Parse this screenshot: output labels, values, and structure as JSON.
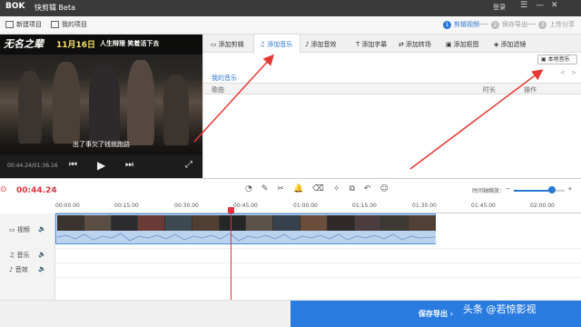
{
  "app": {
    "logo": "ΒOK",
    "title": "快剪辑 Beta",
    "login": "登录"
  },
  "window_controls": {
    "menu": "☰",
    "minimize": "—",
    "close": "✕"
  },
  "toolbar": {
    "new_project": "新建项目",
    "my_projects": "我的项目"
  },
  "steps": [
    {
      "num": "1",
      "label": "剪辑视频",
      "active": true
    },
    {
      "num": "2",
      "label": "保存导出",
      "active": false
    },
    {
      "num": "3",
      "label": "上传分享",
      "active": false
    }
  ],
  "video": {
    "banner_logo": "无名之辈",
    "banner_date": "11月16日",
    "banner_tag": "人生辩理 笑着活下去",
    "subtitle": "出了事欠了钱就跑路",
    "time_readout": "00:44.24/01:36.16"
  },
  "tabs": [
    {
      "label": "添加剪辑",
      "icon": "▭",
      "active": false
    },
    {
      "label": "添加音乐",
      "icon": "♫",
      "active": true
    },
    {
      "label": "添加音效",
      "icon": "♪",
      "active": false
    },
    {
      "label": "添加字幕",
      "icon": "T",
      "active": false
    },
    {
      "label": "添加转场",
      "icon": "⇄",
      "active": false
    },
    {
      "label": "添加抠图",
      "icon": "▣",
      "active": false
    },
    {
      "label": "添加滤镜",
      "icon": "◈",
      "active": false
    }
  ],
  "music_panel": {
    "section_title": "我的音乐",
    "local_music_button": "本地音乐",
    "columns": {
      "song": "歌曲",
      "duration": "时长",
      "action": "操作"
    },
    "nav_prev": "<",
    "nav_next": ">"
  },
  "timeline": {
    "current_time": "00:44.24",
    "zoom_label": "时间轴缩放：",
    "zoom_level": 0.75,
    "zoom_minus": "−",
    "zoom_plus": "+",
    "ticks": [
      "00:00.00",
      "00:15.00",
      "00:30.00",
      "00:45.00",
      "01:00.00",
      "01:15.00",
      "01:30.00",
      "01:45.00",
      "02:00.00"
    ],
    "tracks": [
      {
        "label": "视频",
        "icon": "▭"
      },
      {
        "label": "音乐",
        "icon": "♫"
      },
      {
        "label": "音效",
        "icon": "♪"
      }
    ],
    "tools": [
      "◔",
      "✎",
      "✂",
      "🔔",
      "⌫",
      "✧",
      "⧉",
      "↶",
      "☺"
    ]
  },
  "bottom": {
    "export_button": "保存导出  ›"
  },
  "watermark": "头条 @若惊影视",
  "colors": {
    "accent": "#2a78d3",
    "playhead": "#e0323e",
    "export": "#2a7be0"
  }
}
